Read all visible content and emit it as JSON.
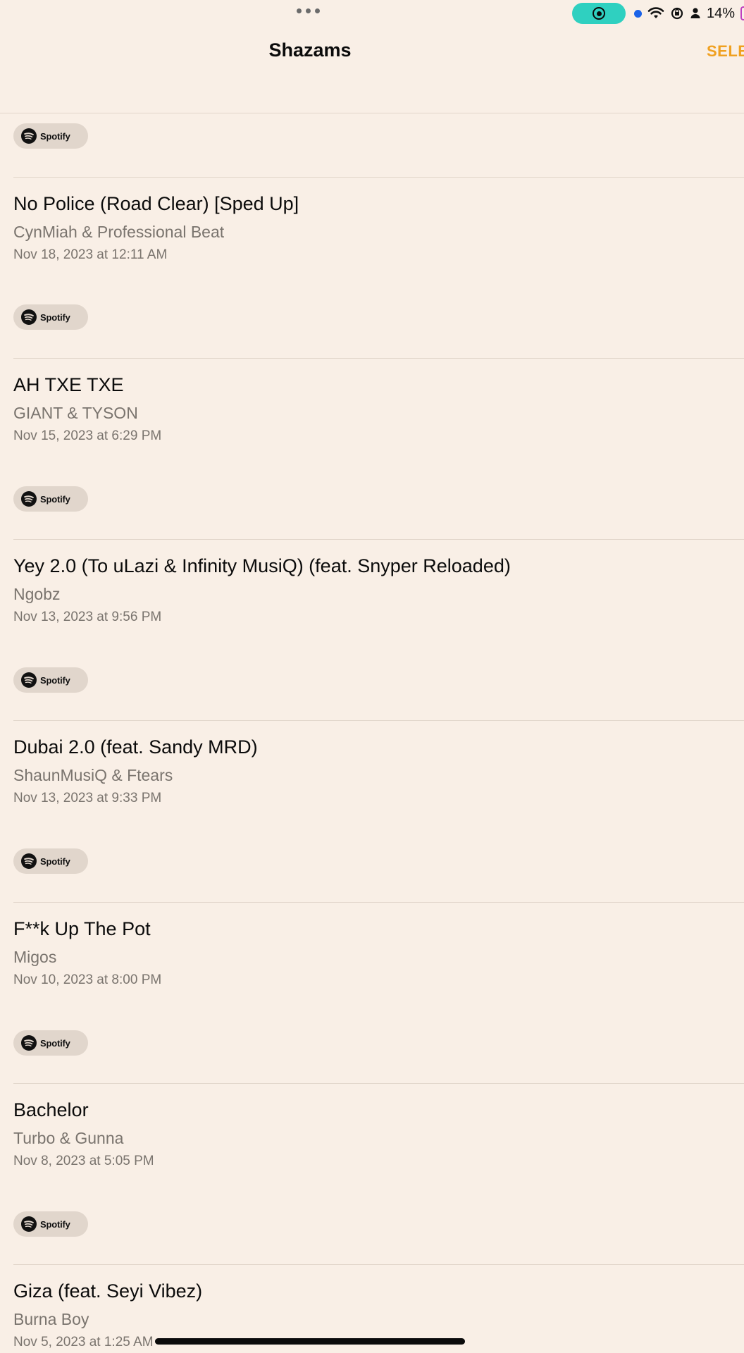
{
  "status_bar": {
    "battery_percent": "14%"
  },
  "nav": {
    "title": "Shazams",
    "select_label": "SELE"
  },
  "spotify_label": "Spotify",
  "songs": [
    {
      "title": "No Police (Road Clear) [Sped Up]",
      "artist": "CynMiah & Professional Beat",
      "date": "Nov 18, 2023 at 12:11 AM"
    },
    {
      "title": "AH TXE TXE",
      "artist": "GIANT & TYSON",
      "date": "Nov 15, 2023 at 6:29 PM"
    },
    {
      "title": "Yey 2.0 (To uLazi & Infinity MusiQ) (feat. Snyper Reloaded)",
      "artist": "Ngobz",
      "date": "Nov 13, 2023 at 9:56 PM"
    },
    {
      "title": "Dubai 2.0 (feat. Sandy MRD)",
      "artist": "ShaunMusiQ & Ftears",
      "date": "Nov 13, 2023 at 9:33 PM"
    },
    {
      "title": "F**k Up The Pot",
      "artist": "Migos",
      "date": "Nov 10, 2023 at 8:00 PM"
    },
    {
      "title": "Bachelor",
      "artist": "Turbo & Gunna",
      "date": "Nov 8, 2023 at 5:05 PM"
    },
    {
      "title": "Giza (feat. Seyi Vibez)",
      "artist": "Burna Boy",
      "date": "Nov 5, 2023 at 1:25 AM"
    }
  ]
}
